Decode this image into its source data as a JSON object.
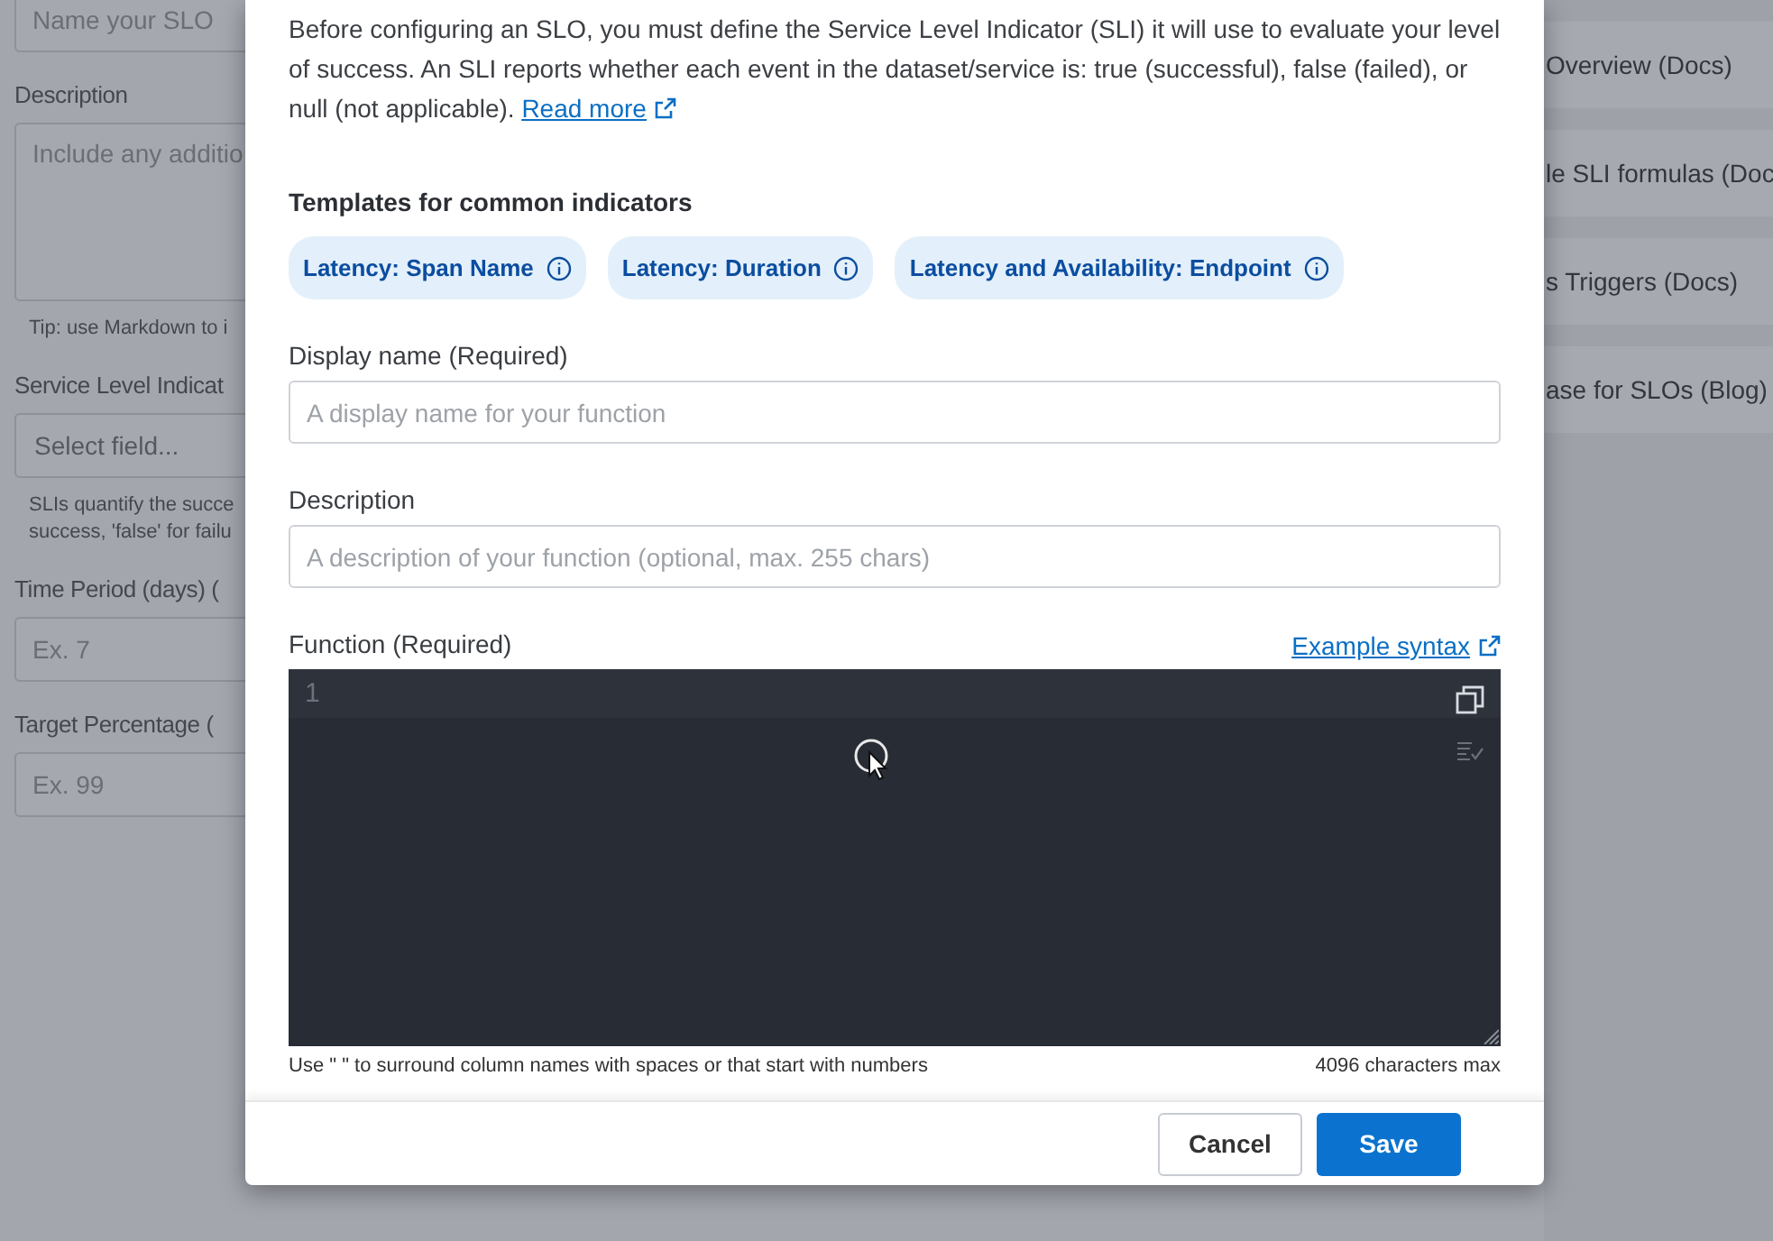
{
  "background_form": {
    "fields": [
      {
        "kind": "input",
        "placeholder": "Name your SLO"
      },
      {
        "kind": "textarea",
        "label": "Description",
        "placeholder": "Include any additio",
        "hint_lines": [
          "Tip: use Markdown to i"
        ]
      },
      {
        "kind": "select",
        "label": "Service Level Indicat",
        "placeholder": "Select field...",
        "hint_lines": [
          "SLIs quantify the succe",
          "success, 'false' for failu"
        ]
      },
      {
        "kind": "input",
        "label": "Time Period (days) (",
        "placeholder": "Ex. 7"
      },
      {
        "kind": "input",
        "label": "Target Percentage (",
        "placeholder": "Ex. 99"
      }
    ]
  },
  "side_links": [
    "Overview (Docs)",
    "le SLI formulas (Doc",
    "s Triggers (Docs)",
    "ase for SLOs (Blog)"
  ],
  "modal": {
    "intro": "Before configuring an SLO, you must define the Service Level Indicator (SLI) it will use to evaluate your level of success. An SLI reports whether each event in the dataset/service is: true (successful), false (failed), or null (not applicable).",
    "read_more": "Read more",
    "templates_heading": "Templates for common indicators",
    "templates": [
      "Latency: Span Name",
      "Latency: Duration",
      "Latency and Availability: Endpoint"
    ],
    "fields": [
      {
        "label": "Display name (Required)",
        "placeholder": "A display name for your function"
      },
      {
        "label": "Description",
        "placeholder": "A description of your function (optional, max. 255 chars)"
      }
    ],
    "function": {
      "label": "Function (Required)",
      "example_link": "Example syntax",
      "line_number": "1",
      "hint": "Use \" \" to surround column names with spaces or that start with numbers",
      "limit": "4096 characters max"
    },
    "buttons": [
      {
        "kind": "secondary",
        "label": "Cancel"
      },
      {
        "kind": "primary",
        "label": "Save"
      }
    ]
  }
}
